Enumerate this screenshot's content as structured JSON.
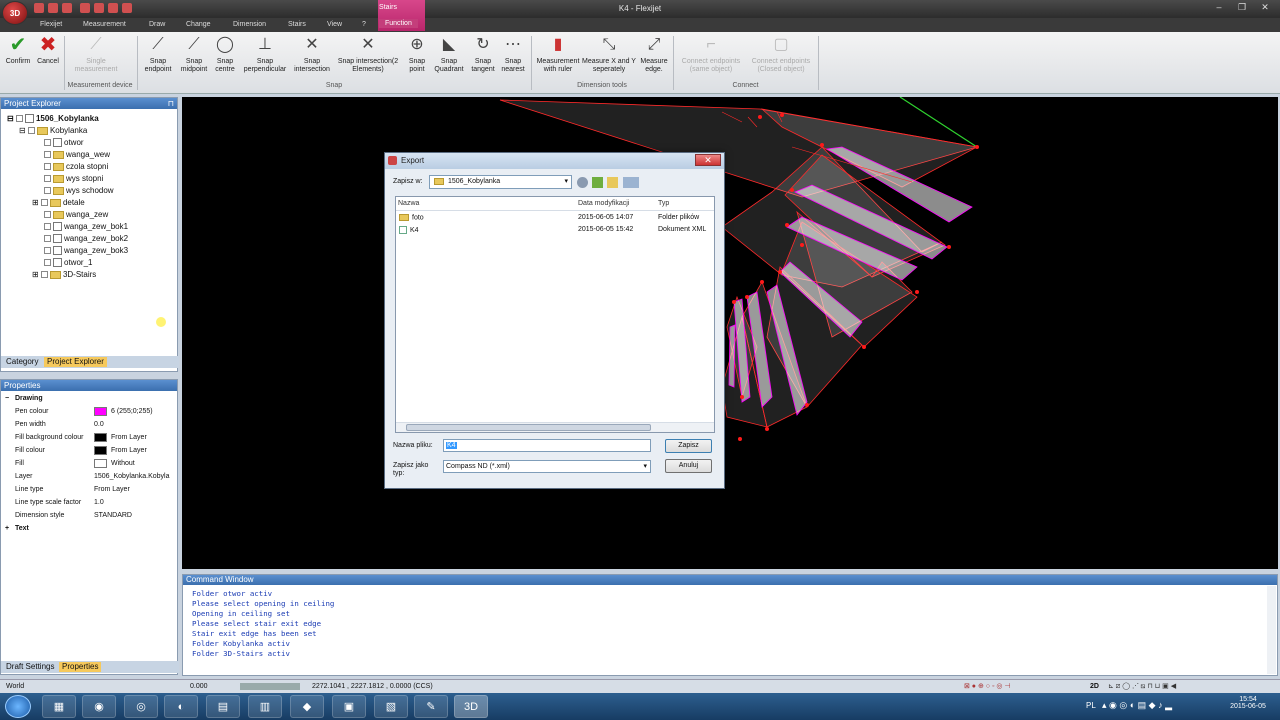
{
  "window": {
    "title": "K4 - Flexijet",
    "context_tab": "Stairs",
    "app_logo": "3D"
  },
  "tabs": [
    {
      "label": "Flexijet"
    },
    {
      "label": "Measurement"
    },
    {
      "label": "Draw"
    },
    {
      "label": "Change"
    },
    {
      "label": "Dimension"
    },
    {
      "label": "Stairs"
    },
    {
      "label": "View"
    },
    {
      "label": "?"
    },
    {
      "label": "Function"
    }
  ],
  "ribbon": {
    "confirm": "Confirm",
    "cancel": "Cancel",
    "single_measurement": "Single measurement",
    "snap_endpoint": "Snap endpoint",
    "snap_midpoint": "Snap midpoint",
    "snap_centre": "Snap centre",
    "snap_perpendicular": "Snap perpendicular",
    "snap_intersection": "Snap intersection",
    "snap_intersection2": "Snap intersection(2 Elements)",
    "snap_point": "Snap point",
    "snap_quadrant": "Snap Quadrant",
    "snap_tangent": "Snap tangent",
    "snap_nearest": "Snap nearest",
    "measurement_ruler": "Measurement with ruler",
    "measure_xy": "Measure X and Y seperately",
    "measure_edge": "Measure edge.",
    "connect_endpoints": "Connect endpoints (same object)",
    "connect_endpoints_closed": "Connect endpoints (Closed object)",
    "groups": {
      "measurement_device": "Measurement device",
      "snap": "Snap",
      "dimension_tools": "Dimension tools",
      "connect": "Connect"
    }
  },
  "project_explorer": {
    "title": "Project Explorer",
    "root": "1506_Kobylanka",
    "folder": "Kobylanka",
    "items": [
      "otwor",
      "wanga_wew",
      "czola stopni",
      "wys stopni",
      "wys schodow",
      "detale",
      "wanga_zew",
      "wanga_zew_bok1",
      "wanga_zew_bok2",
      "wanga_zew_bok3",
      "otwor_1",
      "3D-Stairs"
    ],
    "tabs": [
      "Category",
      "Project Explorer"
    ]
  },
  "properties": {
    "title": "Properties",
    "section_drawing": "Drawing",
    "section_text": "Text",
    "rows": [
      {
        "key": "Pen colour",
        "value": "6 (255;0;255)",
        "swatch": "#ff00ff"
      },
      {
        "key": "Pen width",
        "value": "0.0"
      },
      {
        "key": "Fill background colour",
        "value": "From Layer",
        "swatch": "#000000"
      },
      {
        "key": "Fill colour",
        "value": "From Layer",
        "swatch": "#000000"
      },
      {
        "key": "Fill",
        "value": "Without",
        "swatch": "#ffffff"
      },
      {
        "key": "Layer",
        "value": "1506_Kobylanka.Kobyla"
      },
      {
        "key": "Line type",
        "value": "From Layer"
      },
      {
        "key": "Line type scale factor",
        "value": "1.0"
      },
      {
        "key": "Dimension style",
        "value": "STANDARD"
      }
    ],
    "tabs": [
      "Draft Settings",
      "Properties"
    ]
  },
  "dialog": {
    "title": "Export",
    "save_in_label": "Zapisz w:",
    "save_in_value": "1506_Kobylanka",
    "columns": [
      "Nazwa",
      "Data modyfikacji",
      "Typ"
    ],
    "files": [
      {
        "name": "foto",
        "date": "2015-06-05 14:07",
        "type": "Folder plików"
      },
      {
        "name": "K4",
        "date": "2015-06-05 15:42",
        "type": "Dokument XML"
      }
    ],
    "filename_label": "Nazwa pliku:",
    "filename_value": "K4",
    "savetype_label": "Zapisz jako typ:",
    "savetype_value": "Compass ND (*.xml)",
    "save_button": "Zapisz",
    "cancel_button": "Anuluj"
  },
  "command_window": {
    "title": "Command Window",
    "lines": [
      "Folder otwor activ",
      "Please select opening in ceiling",
      "Opening in ceiling set",
      "Please select stair exit edge",
      "Stair exit edge has been set",
      "Folder Kobylanka activ",
      "Folder 3D-Stairs activ"
    ]
  },
  "status": {
    "world": "World",
    "zoom": "0.000",
    "coords": "2272.1041 , 2227.1812 , 0.0000 (CCS)",
    "mode": "2D"
  },
  "tray": {
    "lang": "PL",
    "time": "15:54",
    "date": "2015-06-05"
  },
  "colors": {
    "accent": "#c43e7b",
    "canvas": "#000000",
    "shape_edge": "#ff2a2a",
    "shape_fill": "#ffffff"
  }
}
